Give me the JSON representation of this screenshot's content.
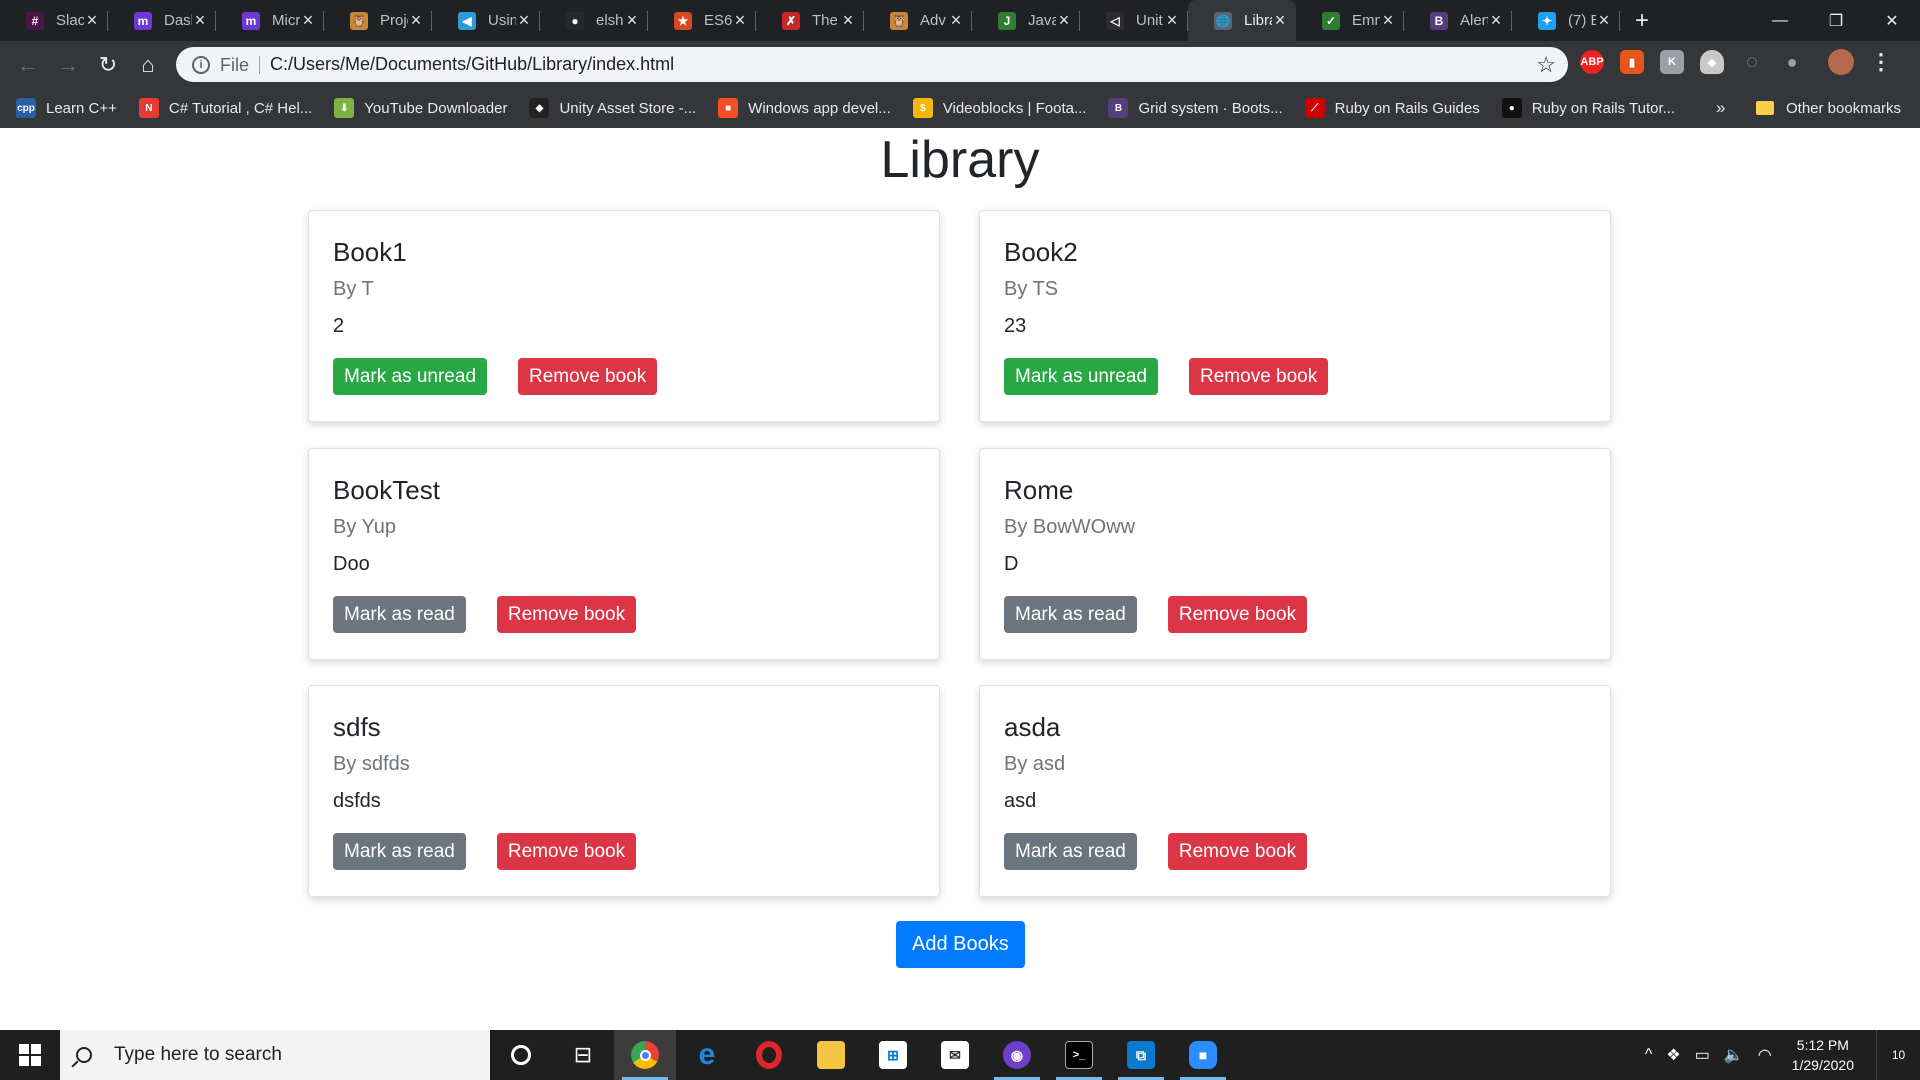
{
  "browser": {
    "tabs": [
      {
        "title": "Slack",
        "icon": "slack-icon",
        "color": "#4a154b",
        "glyph": "#"
      },
      {
        "title": "Dashboard",
        "icon": "m-icon",
        "color": "#6e37d9",
        "glyph": "m"
      },
      {
        "title": "Microverse",
        "icon": "m-icon",
        "color": "#6e37d9",
        "glyph": "m"
      },
      {
        "title": "Projects",
        "icon": "owl-icon",
        "color": "#c6893a",
        "glyph": "🦉"
      },
      {
        "title": "Using",
        "icon": "code-icon",
        "color": "#2d9bd8",
        "glyph": "◀"
      },
      {
        "title": "elsh",
        "icon": "github-icon",
        "color": "#24292e",
        "glyph": "●"
      },
      {
        "title": "ES6",
        "icon": "star-icon",
        "color": "#d4491f",
        "glyph": "★"
      },
      {
        "title": "The",
        "icon": "figure-icon",
        "color": "#c62828",
        "glyph": "✗"
      },
      {
        "title": "Adv",
        "icon": "owl-icon",
        "color": "#c6893a",
        "glyph": "🦉"
      },
      {
        "title": "Java",
        "icon": "js-icon",
        "color": "#2e7d32",
        "glyph": "J"
      },
      {
        "title": "Unit",
        "icon": "vscode-icon",
        "color": "#2d2d30",
        "glyph": "◁"
      },
      {
        "title": "Library",
        "icon": "globe-icon",
        "color": "#5f6368",
        "glyph": "🌐",
        "active": true
      },
      {
        "title": "Emm",
        "icon": "leaf-icon",
        "color": "#2e7d32",
        "glyph": "✓"
      },
      {
        "title": "Alert",
        "icon": "bootstrap-icon",
        "color": "#563d7c",
        "glyph": "B"
      },
      {
        "title": "(7) E",
        "icon": "twitter-icon",
        "color": "#1da1f2",
        "glyph": "✦"
      }
    ],
    "url_scheme": "File",
    "url": "C:/Users/Me/Documents/GitHub/Library/index.html",
    "bookmarks": [
      {
        "label": "Learn C++",
        "icon": "cpp-icon",
        "color": "#2a5fa5",
        "glyph": "cpp"
      },
      {
        "label": "C# Tutorial , C# Hel...",
        "icon": "n-icon",
        "color": "#e53935",
        "glyph": "N"
      },
      {
        "label": "YouTube Downloader",
        "icon": "download-icon",
        "color": "#7cb342",
        "glyph": "⬇"
      },
      {
        "label": "Unity Asset Store -...",
        "icon": "unity-icon",
        "color": "#222",
        "glyph": "◆"
      },
      {
        "label": "Windows app devel...",
        "icon": "windows-icon",
        "color": "#f25022",
        "glyph": "■"
      },
      {
        "label": "Videoblocks | Foota...",
        "icon": "videoblocks-icon",
        "color": "#f2b705",
        "glyph": "$"
      },
      {
        "label": "Grid system · Boots...",
        "icon": "bootstrap-icon",
        "color": "#563d7c",
        "glyph": "B"
      },
      {
        "label": "Ruby on Rails Guides",
        "icon": "rails-icon",
        "color": "#cc0000",
        "glyph": "⟋"
      },
      {
        "label": "Ruby on Rails Tutor...",
        "icon": "rails-icon",
        "color": "#111",
        "glyph": "●"
      }
    ],
    "more_label": "»",
    "other_bookmarks": "Other bookmarks"
  },
  "page": {
    "title": "Library",
    "add_button": "Add Books",
    "books": [
      {
        "title": "Book1",
        "author": "By T",
        "pages": "2",
        "read_label": "Mark as unread",
        "read_state": "read",
        "remove_label": "Remove book"
      },
      {
        "title": "Book2",
        "author": "By TS",
        "pages": "23",
        "read_label": "Mark as unread",
        "read_state": "read",
        "remove_label": "Remove book"
      },
      {
        "title": "BookTest",
        "author": "By Yup",
        "pages": "Doo",
        "read_label": "Mark as read",
        "read_state": "unread",
        "remove_label": "Remove book"
      },
      {
        "title": "Rome",
        "author": "By BowWOww",
        "pages": "D",
        "read_label": "Mark as read",
        "read_state": "unread",
        "remove_label": "Remove book"
      },
      {
        "title": "sdfs",
        "author": "By sdfds",
        "pages": "dsfds",
        "read_label": "Mark as read",
        "read_state": "unread",
        "remove_label": "Remove book"
      },
      {
        "title": "asda",
        "author": "By asd",
        "pages": "asd",
        "read_label": "Mark as read",
        "read_state": "unread",
        "remove_label": "Remove book"
      }
    ],
    "colors": {
      "read_button": "#28a745",
      "unread_button": "#6c757d",
      "remove_button": "#dc3545",
      "add_button": "#007bff"
    }
  },
  "taskbar": {
    "search_placeholder": "Type here to search",
    "time": "5:12 PM",
    "date": "1/29/2020",
    "notification_count": "10"
  }
}
